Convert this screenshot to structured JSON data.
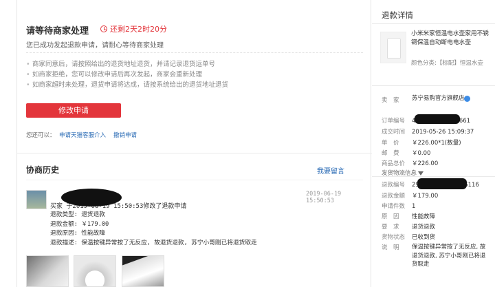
{
  "status": {
    "title": "请等待商家处理",
    "countdown": "还剩2天2时20分",
    "subtitle": "您已成功发起退款申请，请耐心等待商家处理",
    "tips": [
      "商家同意后，请按照给出的退货地址退货，并请记录退货运单号",
      "如商家拒绝，您可以修改申请后再次发起，商家会重新处理",
      "如商家超时未处理，退货申请将达成，请按系统给出的退货地址退货"
    ],
    "modify_label": "修改申请",
    "also_label": "您还可以：",
    "link_appeal": "申请天猫客服介入",
    "link_cancel": "撤销申请"
  },
  "history": {
    "title": "协商历史",
    "leave_message": "我要留言",
    "entry": {
      "time": "2019-06-19 15:50:53",
      "line": "买家      于2019-06-19 15:50:53修改了退款申请",
      "details": [
        "退款类型: 退货退款",
        "退款金额: ￥179.00",
        "退款原因: 性能故障",
        "退款描述: 保温按键异常按了无反应, 故退货退款, 苏宁小哥刚已将退货取走"
      ]
    }
  },
  "detail": {
    "title": "退款详情",
    "product_name": "小米米家恒温电水壶家用不锈钢保温自动断电电水壶",
    "product_category": "颜色分类:【标配】恒温水壶",
    "seller_label": "卖　家",
    "seller_value": "苏宁易购官方旗舰店",
    "order_no_label": "订单编号",
    "order_no_prefix": "45",
    "order_no_suffix": "661",
    "deal_time_label": "成交时间",
    "deal_time_value": "2019-05-26 15:09:37",
    "price_label": "单　价",
    "price_value": "￥226.00*1(数量)",
    "shipping_label": "邮　费",
    "shipping_value": "￥0.00",
    "total_label": "商品总价",
    "total_value": "￥226.00",
    "logistics_label": "发货物流信息",
    "refund_no_label": "退款编号",
    "refund_no_prefix": "29",
    "refund_no_suffix": "96116",
    "refund_amount_label": "退款金额",
    "refund_amount_value": "￥179.00",
    "apply_count_label": "申请件数",
    "apply_count_value": "1",
    "reason_label": "原　因",
    "reason_value": "性能故障",
    "require_label": "要　求",
    "require_value": "退货退款",
    "goods_status_label": "货物状态",
    "goods_status_value": "已收到货",
    "desc_label": "说　明",
    "desc_value": "保温按键异常按了无反应, 故退货退款, 苏宁小哥刚已将退货取走"
  }
}
